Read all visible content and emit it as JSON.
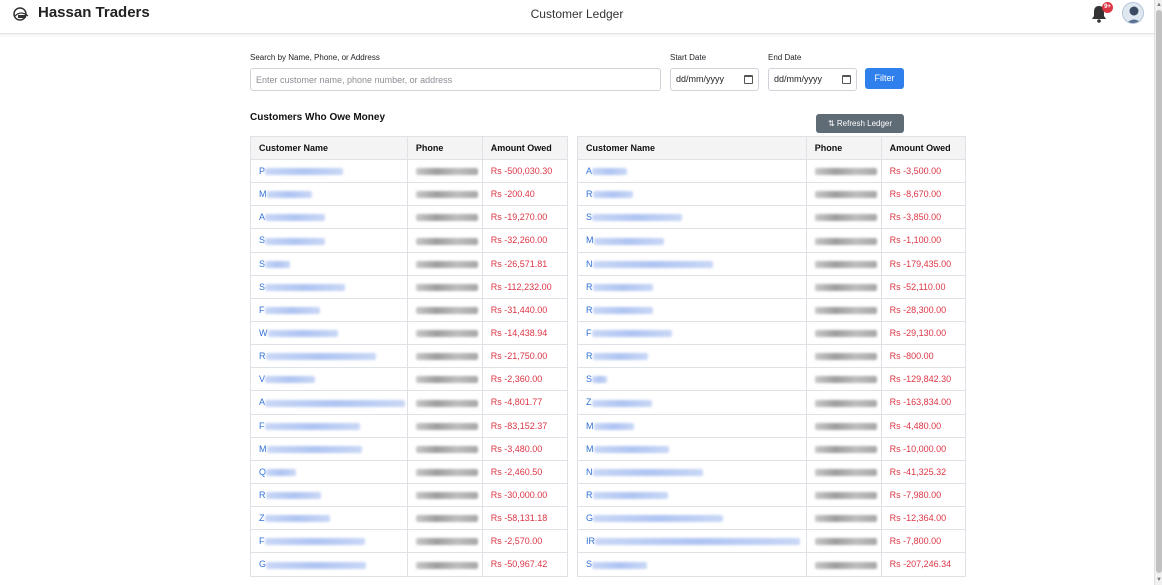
{
  "header": {
    "brand": "Hassan Traders",
    "title": "Customer Ledger",
    "notification_badge": "9+"
  },
  "filters": {
    "search_label": "Search by Name, Phone, or Address",
    "search_placeholder": "Enter customer name, phone number, or address",
    "start_label": "Start Date",
    "start_value": "dd/mm/yyyy",
    "end_label": "End Date",
    "end_value": "dd/mm/yyyy",
    "filter_button": "Filter"
  },
  "section": {
    "title": "Customers Who Owe Money",
    "refresh_button": "Refresh Ledger"
  },
  "table_headers": [
    "Customer Name",
    "Phone",
    "Amount Owed"
  ],
  "left_table": [
    {
      "name": "P",
      "amount": "Rs -500,030.30"
    },
    {
      "name": "M",
      "amount": "Rs -200.40"
    },
    {
      "name": "A",
      "amount": "Rs -19,270.00"
    },
    {
      "name": "S",
      "amount": "Rs -32,260.00"
    },
    {
      "name": "S",
      "amount": "Rs -26,571.81"
    },
    {
      "name": "S",
      "amount": "Rs -112,232.00"
    },
    {
      "name": "F",
      "amount": "Rs -31,440.00"
    },
    {
      "name": "W",
      "amount": "Rs -14,438.94"
    },
    {
      "name": "R",
      "amount": "Rs -21,750.00"
    },
    {
      "name": "V",
      "amount": "Rs -2,360.00"
    },
    {
      "name": "A",
      "amount": "Rs -4,801.77"
    },
    {
      "name": "F",
      "amount": "Rs -83,152.37"
    },
    {
      "name": "M",
      "amount": "Rs -3,480.00"
    },
    {
      "name": "Q",
      "amount": "Rs -2,460.50"
    },
    {
      "name": "R",
      "amount": "Rs -30,000.00"
    },
    {
      "name": "Z",
      "amount": "Rs -58,131.18"
    },
    {
      "name": "F",
      "amount": "Rs -2,570.00"
    },
    {
      "name": "G",
      "amount": "Rs -50,967.42"
    }
  ],
  "right_table": [
    {
      "name": "A",
      "amount": "Rs -3,500.00"
    },
    {
      "name": "R",
      "amount": "Rs -8,670.00"
    },
    {
      "name": "S",
      "amount": "Rs -3,850.00"
    },
    {
      "name": "M",
      "amount": "Rs -1,100.00"
    },
    {
      "name": "N",
      "amount": "Rs -179,435.00"
    },
    {
      "name": "R",
      "amount": "Rs -52,110.00"
    },
    {
      "name": "R",
      "amount": "Rs -28,300.00"
    },
    {
      "name": "F",
      "amount": "Rs -29,130.00"
    },
    {
      "name": "R",
      "amount": "Rs -800.00"
    },
    {
      "name": "S",
      "amount": "Rs -129,842.30"
    },
    {
      "name": "Z",
      "amount": "Rs -163,834.00"
    },
    {
      "name": "M",
      "amount": "Rs -4,480.00"
    },
    {
      "name": "M",
      "amount": "Rs -10,000.00"
    },
    {
      "name": "N",
      "amount": "Rs -41,325.32"
    },
    {
      "name": "R",
      "amount": "Rs -7,980.00"
    },
    {
      "name": "G",
      "amount": "Rs -12,364.00"
    },
    {
      "name": "IR",
      "amount": "Rs -7,800.00"
    },
    {
      "name": "S",
      "amount": "Rs -207,246.34"
    }
  ],
  "colors": {
    "accent": "#2f80ed",
    "owed": "#dc3545",
    "link": "#2f6fd6",
    "refresh_button": "#5f6b75"
  },
  "icons": [
    "logo-icon",
    "bell-icon",
    "avatar-icon",
    "calendar-icon",
    "swap-icon"
  ]
}
